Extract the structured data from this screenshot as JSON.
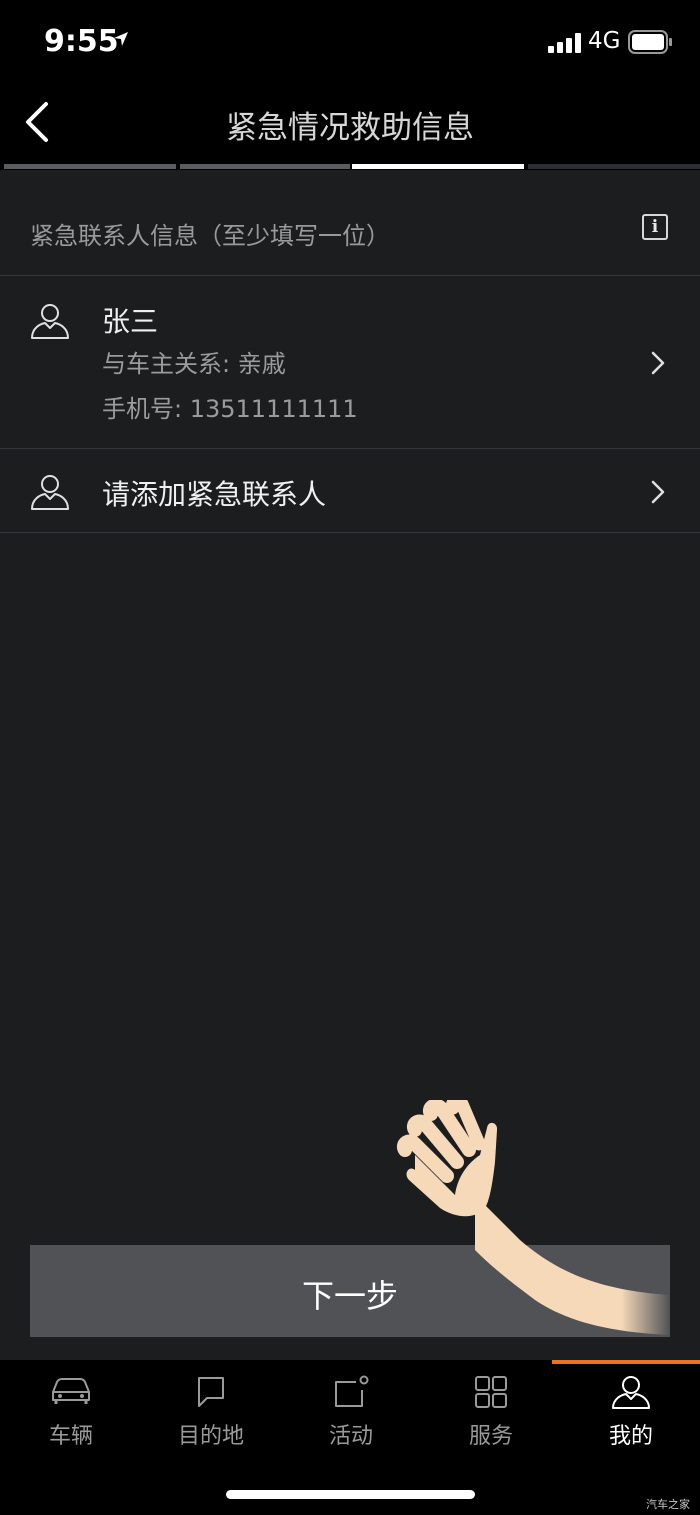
{
  "status_bar": {
    "time": "9:55",
    "network": "4G"
  },
  "nav": {
    "title": "紧急情况救助信息"
  },
  "progress": {
    "steps_total": 4,
    "current_step": 3
  },
  "section": {
    "title": "紧急联系人信息（至少填写一位）"
  },
  "contacts": [
    {
      "name": "张三",
      "relation": "与车主关系: 亲戚",
      "phone": "手机号: 13511111111"
    }
  ],
  "add_contact": {
    "label": "请添加紧急联系人"
  },
  "next_button": {
    "label": "下一步"
  },
  "tabs": [
    {
      "label": "车辆",
      "icon": "car-icon"
    },
    {
      "label": "目的地",
      "icon": "chat-bubble-icon"
    },
    {
      "label": "活动",
      "icon": "activity-icon"
    },
    {
      "label": "服务",
      "icon": "grid-icon"
    },
    {
      "label": "我的",
      "icon": "person-icon",
      "active": true
    }
  ],
  "watermark": "汽车之家",
  "colors": {
    "accent": "#f36f21",
    "background": "#1c1d1f",
    "button": "#505256"
  }
}
